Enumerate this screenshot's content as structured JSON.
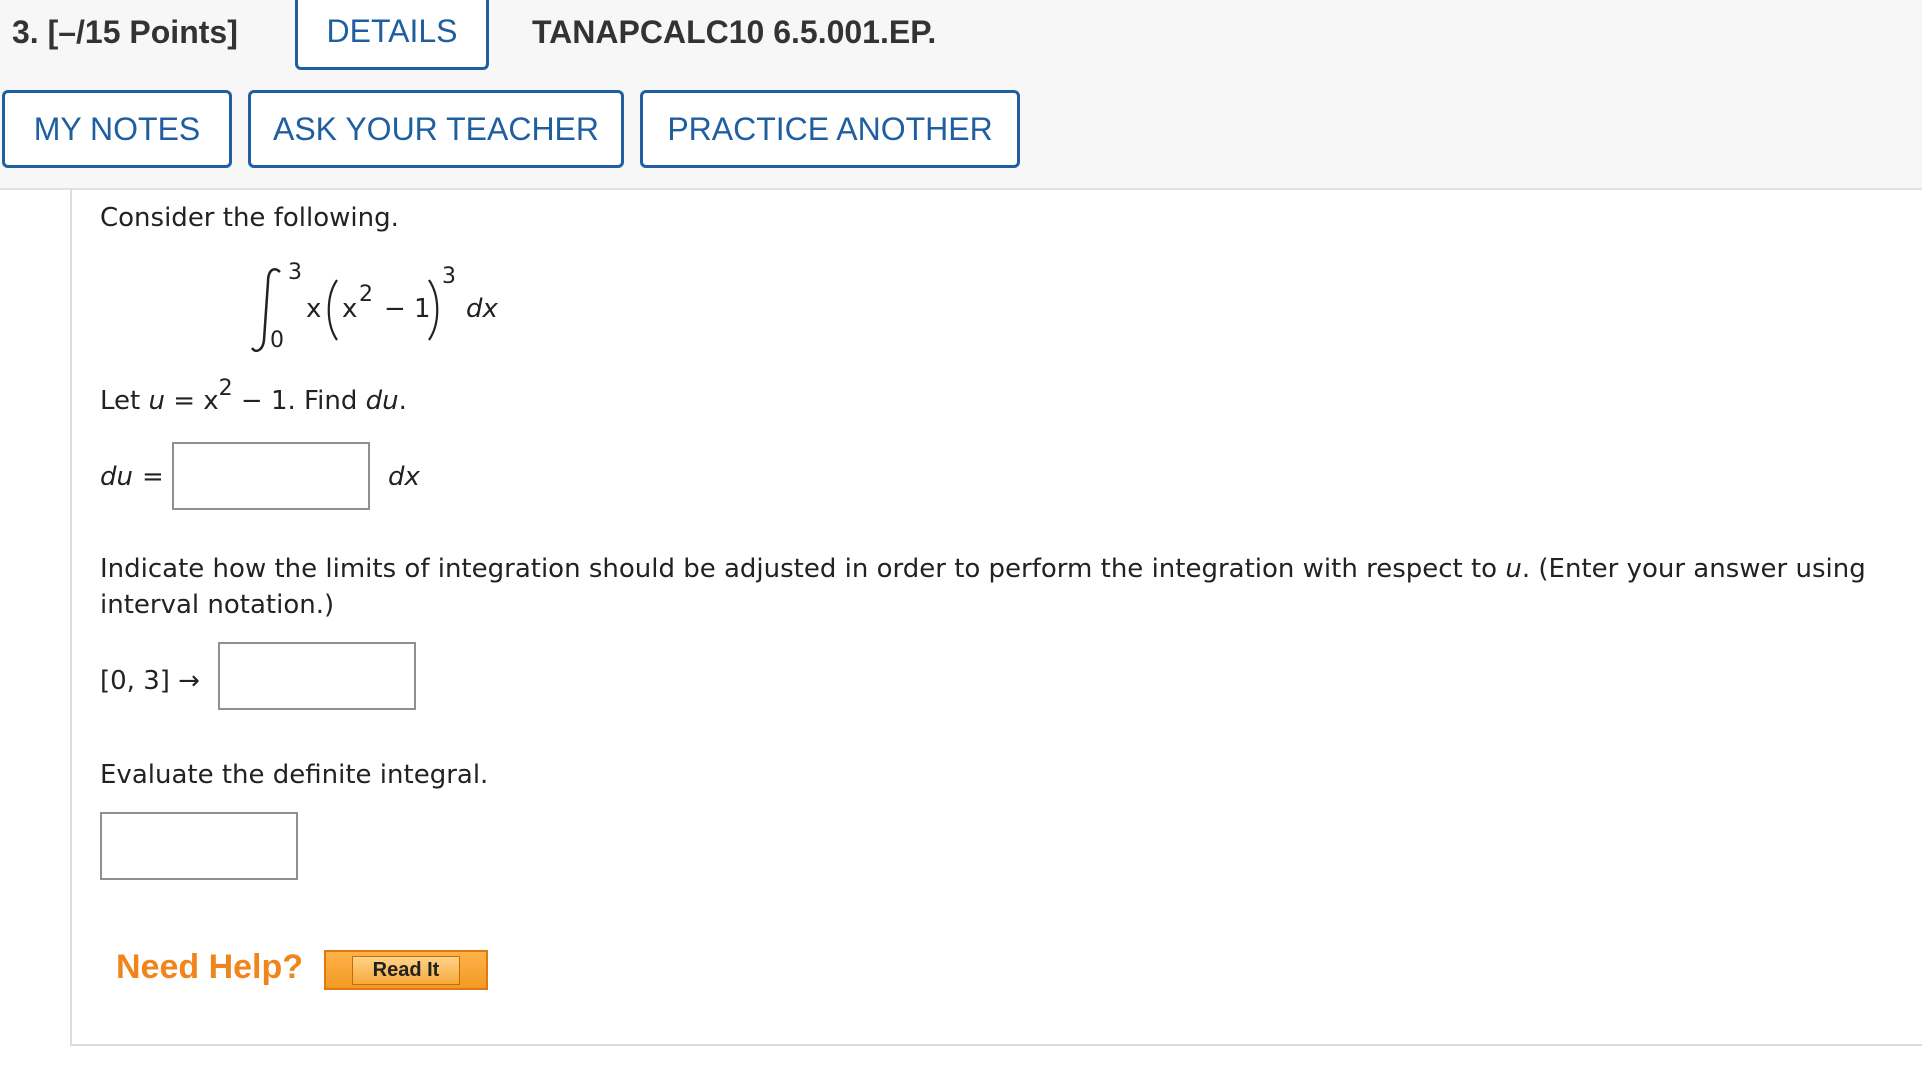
{
  "header": {
    "question_label": "3. [–/15 Points]",
    "details_tab": "DETAILS",
    "assignment_code": "TANAPCALC10 6.5.001.EP.",
    "buttons": {
      "my_notes": "MY NOTES",
      "ask_teacher": "ASK YOUR TEACHER",
      "practice_another": "PRACTICE ANOTHER"
    }
  },
  "problem": {
    "intro": "Consider the following.",
    "integral": {
      "upper_limit": "3",
      "lower_limit": "0",
      "integrand_x": "x",
      "inner_base": "x",
      "inner_exp": "2",
      "inner_rest": "− 1",
      "outer_exp": "3",
      "differential": "dx"
    },
    "let_prefix": "Let ",
    "let_u": "u",
    "let_eq": " = x",
    "let_exp": "2",
    "let_rest": " − 1. Find ",
    "let_du": "du",
    "let_end": ".",
    "du_label": "du",
    "du_eq": "=",
    "du_suffix": "dx",
    "du_input": "",
    "limits_text_1": "Indicate how the limits of integration should be adjusted in order to perform the integration with respect to ",
    "limits_u": "u",
    "limits_text_2": ". (Enter your answer using",
    "limits_text_line2": "interval notation.)",
    "interval_label": "[0, 3] →",
    "interval_input": "",
    "evaluate_text": "Evaluate the definite integral.",
    "evaluate_input": ""
  },
  "help": {
    "label": "Need Help?",
    "read_it": "Read It"
  }
}
